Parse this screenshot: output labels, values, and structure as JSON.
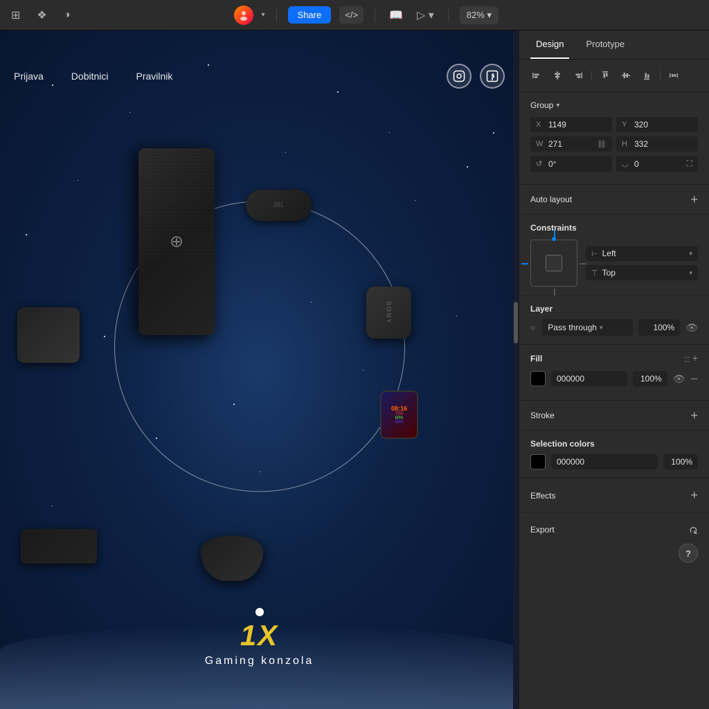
{
  "topbar": {
    "three_dots": "···",
    "grid_icon": "⊞",
    "component_icon": "❖",
    "contrast_icon": "◑",
    "avatar_text": "👤",
    "avatar_chevron": "▾",
    "share_label": "Share",
    "code_btn": "</>",
    "book_icon": "📖",
    "play_icon": "▷",
    "zoom_label": "82%",
    "zoom_chevron": "▾"
  },
  "canvas": {
    "nav_links": [
      "Prijava",
      "Dobitnici",
      "Pravilnik"
    ],
    "social_icons": [
      "instagram",
      "facebook"
    ],
    "quantity": "1X",
    "product_name": "Gaming konzola"
  },
  "right_panel": {
    "tabs": [
      "Design",
      "Prototype"
    ],
    "active_tab": "Design",
    "align_icons": [
      "align-left",
      "align-center-h",
      "align-right",
      "align-top",
      "align-center-v",
      "align-bottom",
      "distribute"
    ],
    "group_label": "Group",
    "group_chevron": "▾",
    "x_label": "X",
    "x_value": "1149",
    "y_label": "Y",
    "y_value": "320",
    "w_label": "W",
    "w_value": "271",
    "h_label": "H",
    "h_value": "332",
    "rotation_label": "↺",
    "rotation_value": "0°",
    "corner_label": "◡",
    "corner_value": "0",
    "auto_layout_label": "Auto layout",
    "constraints_label": "Constraints",
    "constraint_h_label": "⊢",
    "constraint_h_value": "Left",
    "constraint_v_label": "⊤",
    "constraint_v_value": "Top",
    "layer_label": "Layer",
    "layer_mode": "Pass through",
    "layer_opacity": "100%",
    "fill_label": "Fill",
    "fill_color": "#000000",
    "fill_hex": "000000",
    "fill_opacity": "100%",
    "stroke_label": "Stroke",
    "selection_colors_label": "Selection colors",
    "sel_color_hex": "000000",
    "sel_color_opacity": "100%",
    "effects_label": "Effects",
    "export_label": "Export",
    "export_arrow": "↺",
    "help_label": "?"
  }
}
